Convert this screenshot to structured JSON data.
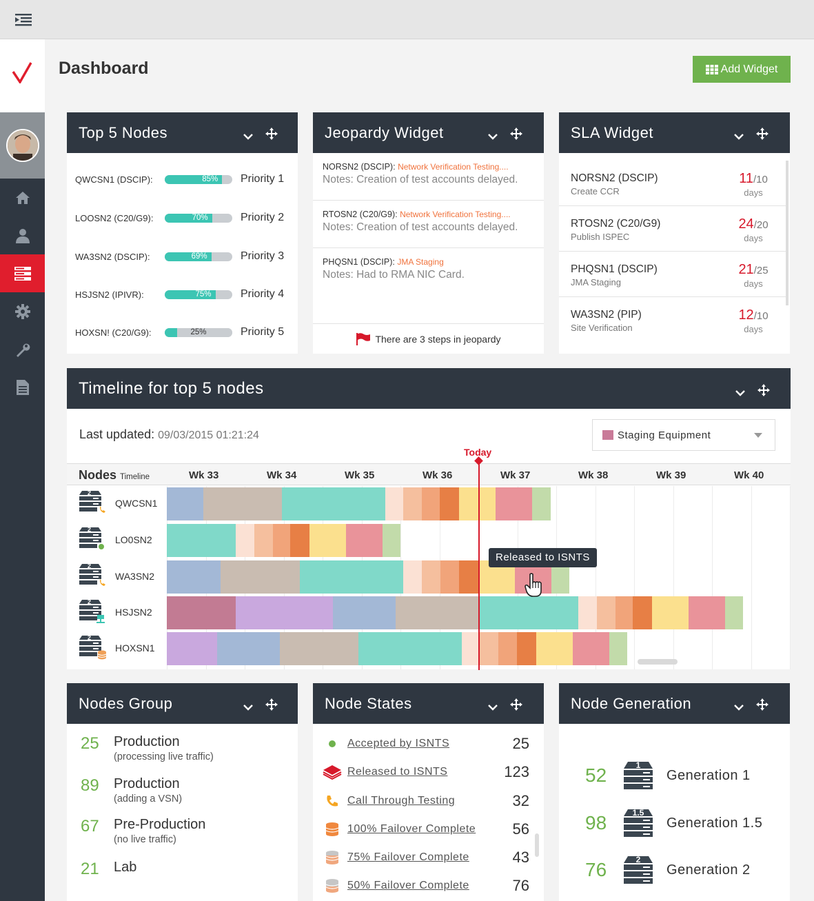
{
  "page": {
    "title": "Dashboard",
    "add_widget": "Add Widget"
  },
  "colors": {
    "accent_red": "#e01e2d",
    "header_dark": "#2f3741",
    "green": "#6fb24d",
    "teal": "#3cc5b3",
    "orange": "#f0723c"
  },
  "top5": {
    "title": "Top 5 Nodes",
    "rows": [
      {
        "name": "QWCSN1 (DSCIP):",
        "percent": "85%",
        "fill": 0.85,
        "priority": "Priority 1"
      },
      {
        "name": "LOOSN2 (C20/G9):",
        "percent": "70%",
        "fill": 0.7,
        "priority": "Priority 2"
      },
      {
        "name": "WA3SN2 (DSCIP):",
        "percent": "69%",
        "fill": 0.69,
        "priority": "Priority 3"
      },
      {
        "name": "HSJSN2 (IPIVR):",
        "percent": "75%",
        "fill": 0.75,
        "priority": "Priority 4"
      },
      {
        "name": "HOXSN! (C20/G9):",
        "percent": "25%",
        "fill": 0.25,
        "priority": "Priority 5"
      }
    ]
  },
  "jeopardy": {
    "title": "Jeopardy Widget",
    "rows": [
      {
        "node": "NORSN2 (DSCIP):",
        "task": "Network Verification Testing....",
        "note": "Notes: Creation of test accounts delayed."
      },
      {
        "node": "RTOSN2 (C20/G9):",
        "task": "Network Verification Testing....",
        "note": "Notes: Creation of test accounts delayed."
      },
      {
        "node": "PHQSN1 (DSCIP):",
        "task": "JMA Staging",
        "note": "Notes: Had to RMA NIC Card."
      }
    ],
    "footer": "There are 3 steps in jeopardy"
  },
  "sla": {
    "title": "SLA Widget",
    "rows": [
      {
        "node": "NORSN2 (DSCIP)",
        "task": "Create CCR",
        "value": "11",
        "target": "/10",
        "unit": "days"
      },
      {
        "node": "RTOSN2 (C20/G9)",
        "task": "Publish ISPEC",
        "value": "24",
        "target": "/20",
        "unit": "days"
      },
      {
        "node": "PHQSN1 (DSCIP)",
        "task": "JMA Staging",
        "value": "21",
        "target": "/25",
        "unit": "days"
      },
      {
        "node": "WA3SN2 (PIP)",
        "task": "Site Verification",
        "value": "12",
        "target": "/10",
        "unit": "days"
      }
    ]
  },
  "timeline": {
    "title": "Timeline for top 5 nodes",
    "last_updated_label": "Last updated:",
    "last_updated_value": "09/03/2015  01:21:24",
    "select_value": "Staging Equipment",
    "today_label": "Today",
    "nodes_header": "Nodes",
    "timeline_header": "Timeline",
    "weeks": [
      "Wk 33",
      "Wk 34",
      "Wk 35",
      "Wk 36",
      "Wk 37",
      "Wk 38",
      "Wk 39",
      "Wk 40"
    ],
    "tooltip": "Released to ISNTS",
    "rows": [
      {
        "name": "QWCSN1",
        "badge": "2",
        "icon": "phone-icon"
      },
      {
        "name": "LO0SN2",
        "badge": "2",
        "icon": "dot-icon"
      },
      {
        "name": "WA3SN2",
        "badge": "2",
        "icon": "phone-icon"
      },
      {
        "name": "HSJSN2",
        "badge": "2",
        "icon": "network-icon"
      },
      {
        "name": "HOXSN1",
        "badge": "2",
        "icon": "database-icon"
      }
    ]
  },
  "nodes_group": {
    "title": "Nodes Group",
    "rows": [
      {
        "count": "25",
        "label": "Production",
        "sub": "(processing live traffic)"
      },
      {
        "count": "89",
        "label": "Production",
        "sub": "(adding a VSN)"
      },
      {
        "count": "67",
        "label": "Pre-Production",
        "sub": "(no live traffic)"
      },
      {
        "count": "21",
        "label": "Lab",
        "sub": ""
      }
    ]
  },
  "node_states": {
    "title": "Node States",
    "rows": [
      {
        "label": "Accepted by ISNTS",
        "value": "25",
        "icon": "green-dot-icon"
      },
      {
        "label": "Released to ISNTS",
        "value": "123",
        "icon": "stack-icon"
      },
      {
        "label": "Call Through Testing",
        "value": "32",
        "icon": "phone-icon"
      },
      {
        "label": "100% Failover Complete",
        "value": "56",
        "icon": "database-full-icon"
      },
      {
        "label": "75% Failover Complete",
        "value": "43",
        "icon": "database-75-icon"
      },
      {
        "label": "50% Failover Complete",
        "value": "76",
        "icon": "database-50-icon"
      }
    ]
  },
  "node_generation": {
    "title": "Node Generation",
    "rows": [
      {
        "count": "52",
        "badge": "1",
        "label": "Generation 1"
      },
      {
        "count": "98",
        "badge": "1.5",
        "label": "Generation 1.5"
      },
      {
        "count": "76",
        "badge": "2",
        "label": "Generation 2"
      }
    ]
  }
}
